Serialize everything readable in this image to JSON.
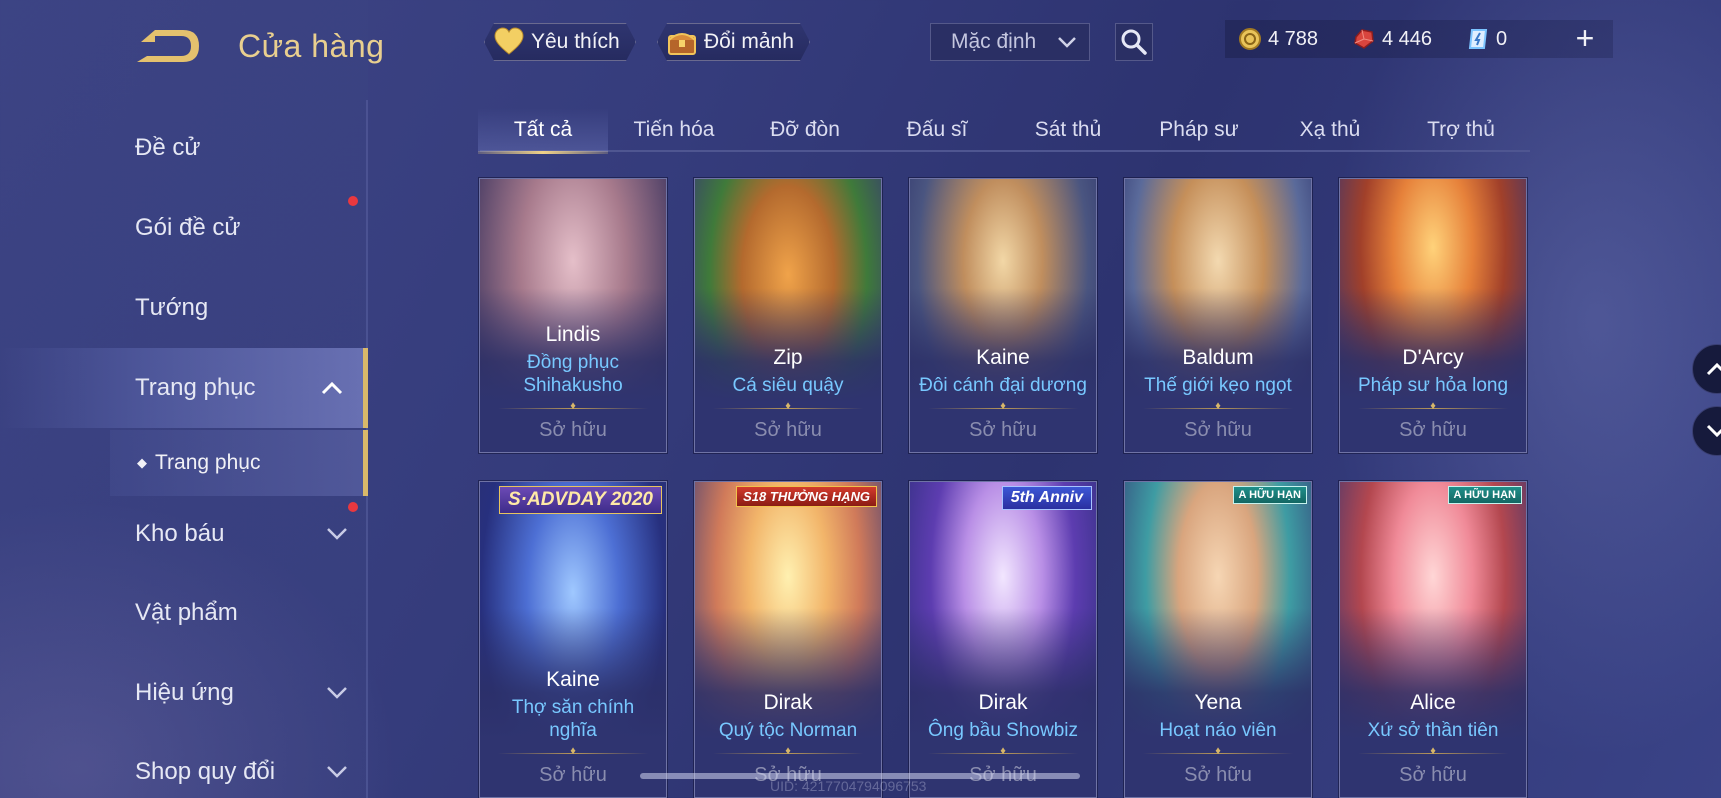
{
  "header": {
    "title": "Cửa hàng",
    "favorites_label": "Yêu thích",
    "exchange_label": "Đổi mảnh",
    "sort_value": "Mặc định"
  },
  "currencies": {
    "gold": "4 788",
    "ruby": "4 446",
    "voucher": "0",
    "gold_color": "#e9c45a",
    "ruby_color": "#d9453e",
    "voucher_color": "#7cc4ff"
  },
  "sidebar": {
    "items": [
      {
        "label": "Đề cử"
      },
      {
        "label": "Gói đề cử"
      },
      {
        "label": "Tướng"
      },
      {
        "label": "Trang phục"
      },
      {
        "label": "Kho báu"
      },
      {
        "label": "Vật phẩm"
      },
      {
        "label": "Hiệu ứng"
      },
      {
        "label": "Shop quy đổi"
      }
    ],
    "sub_item": "Trang phục",
    "accent_color": "#d9b86a"
  },
  "tabs": [
    {
      "label": "Tất cả"
    },
    {
      "label": "Tiến hóa"
    },
    {
      "label": "Đỡ đòn"
    },
    {
      "label": "Đấu sĩ"
    },
    {
      "label": "Sát thủ"
    },
    {
      "label": "Pháp sư"
    },
    {
      "label": "Xạ thủ"
    },
    {
      "label": "Trợ thủ"
    }
  ],
  "cards": [
    {
      "hero": "Lindis",
      "skin": "Đồng phục Shihakusho",
      "status": "Sở hữu",
      "badge": ""
    },
    {
      "hero": "Zip",
      "skin": "Cá siêu quậy",
      "status": "Sở hữu",
      "badge": ""
    },
    {
      "hero": "Kaine",
      "skin": "Đôi cánh đại dương",
      "status": "Sở hữu",
      "badge": ""
    },
    {
      "hero": "Baldum",
      "skin": "Thế giới kẹo ngọt",
      "status": "Sở hữu",
      "badge": ""
    },
    {
      "hero": "D'Arcy",
      "skin": "Pháp sư hỏa long",
      "status": "Sở hữu",
      "badge": ""
    },
    {
      "hero": "Kaine",
      "skin": "Thợ săn chính nghĩa",
      "status": "Sở hữu",
      "badge": "S·ADVDAY 2020"
    },
    {
      "hero": "Dirak",
      "skin": "Quý tộc Norman",
      "status": "Sở hữu",
      "badge": "S18 THƯỞNG HẠNG"
    },
    {
      "hero": "Dirak",
      "skin": "Ông bầu Showbiz",
      "status": "Sở hữu",
      "badge": "5th Anniv"
    },
    {
      "hero": "Yena",
      "skin": "Hoạt náo viên",
      "status": "Sở hữu",
      "badge": "A HỮU HẠN"
    },
    {
      "hero": "Alice",
      "skin": "Xứ sở thần tiên",
      "status": "Sở hữu",
      "badge": "A HỮU HẠN"
    }
  ],
  "footer": {
    "uid": "UID: 4217704794096753"
  }
}
